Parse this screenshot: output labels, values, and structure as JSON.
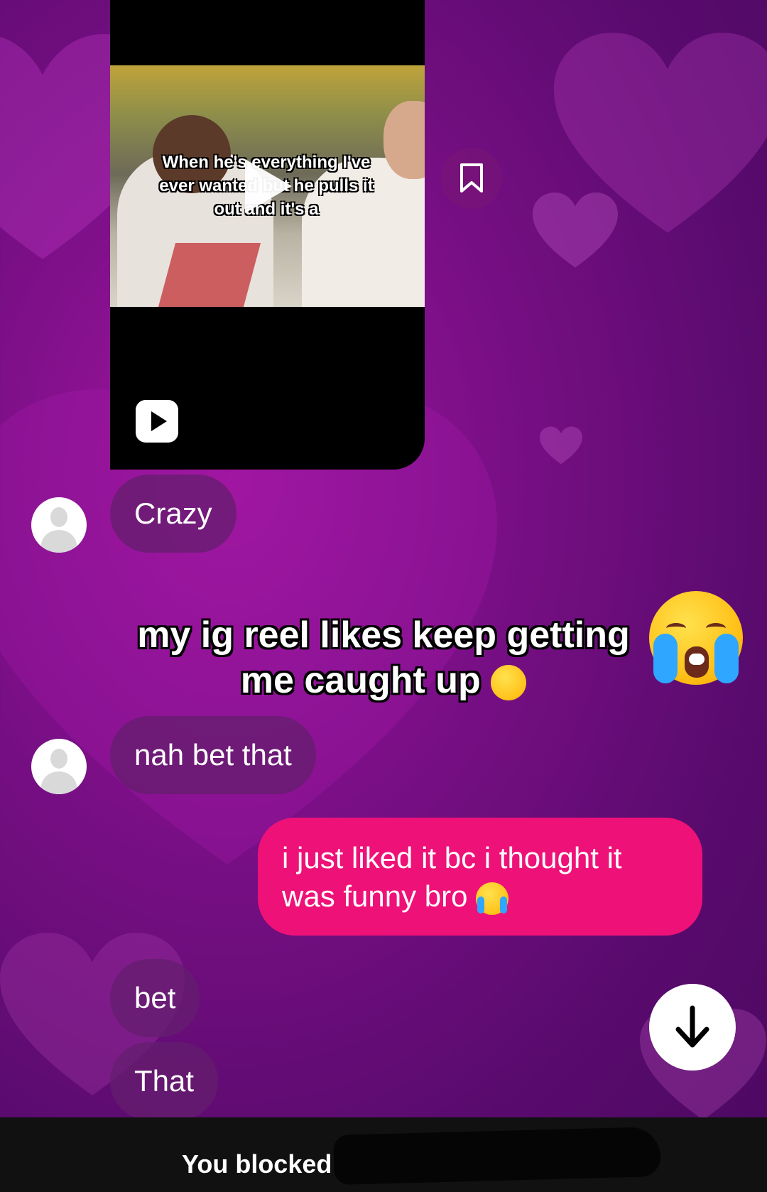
{
  "reel": {
    "caption": "When he's everything I've ever wanted but he pulls it out and it's a"
  },
  "messages": [
    {
      "id": "m1",
      "direction": "incoming",
      "text": "Crazy"
    },
    {
      "id": "m2",
      "direction": "incoming",
      "text": "nah bet that"
    },
    {
      "id": "m3",
      "direction": "outgoing",
      "text": "i just liked it bc i thought it was funny bro"
    },
    {
      "id": "m4",
      "direction": "incoming",
      "text": "bet"
    },
    {
      "id": "m5",
      "direction": "incoming",
      "text": "That"
    }
  ],
  "overlay": {
    "caption": "my ig reel likes keep getting me caught up"
  },
  "footer": {
    "text": "You blocked"
  },
  "icons": {
    "save": "bookmark-icon",
    "reel": "reels-play-icon",
    "scroll": "arrow-down-icon",
    "overlay_emoji": "loudly-crying-face-emoji",
    "caption_emoji": "flushed-face-emoji"
  },
  "colors": {
    "outgoing_bubble": "#ee1178",
    "incoming_bubble": "#641e6e",
    "background": "#7a0f86"
  }
}
